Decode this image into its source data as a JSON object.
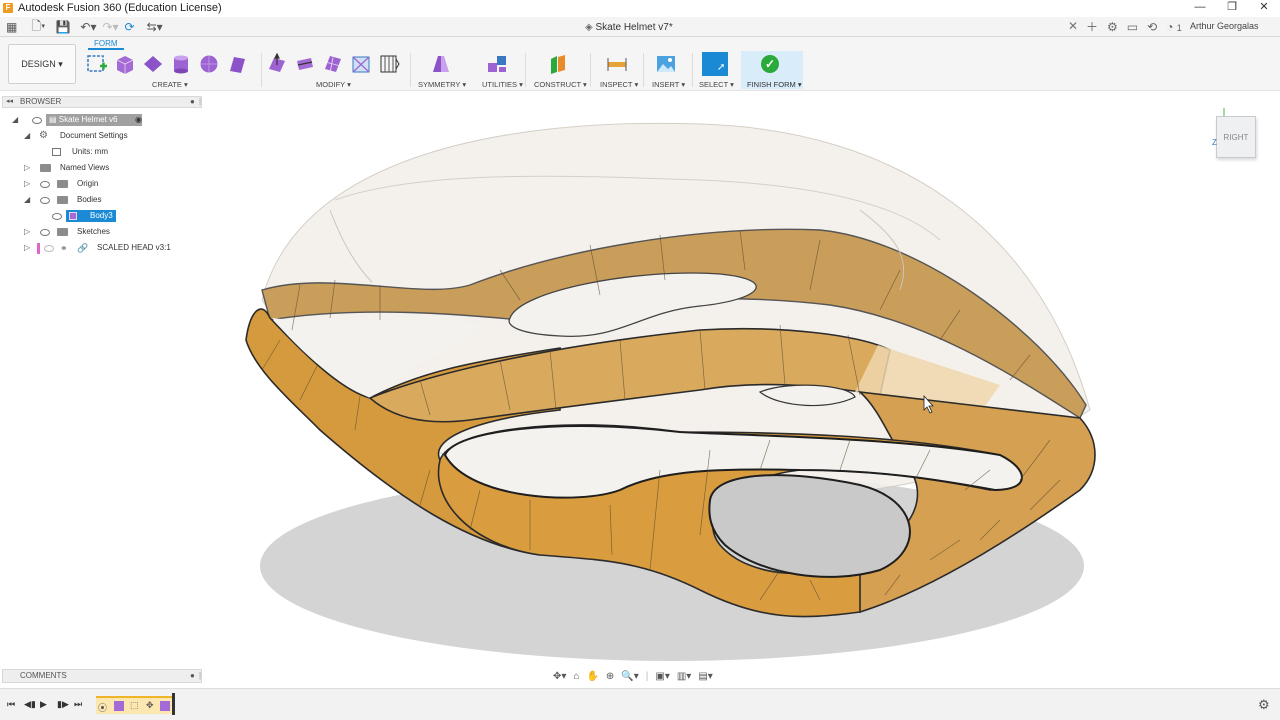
{
  "window": {
    "title": "Autodesk Fusion 360 (Education License)",
    "controls": [
      "—",
      "❐",
      "✕"
    ]
  },
  "tabbar": {
    "doc_tab": "Skate Helmet v7*",
    "notifications": "1",
    "user": "Arthur Georgalas"
  },
  "toolbar": {
    "workspace": "DESIGN",
    "active_tab": "FORM",
    "groups": {
      "create": "CREATE",
      "modify": "MODIFY",
      "symmetry": "SYMMETRY",
      "utilities": "UTILITIES",
      "construct": "CONSTRUCT",
      "inspect": "INSPECT",
      "insert": "INSERT",
      "select": "SELECT",
      "finish": "FINISH FORM"
    }
  },
  "browser": {
    "title": "BROWSER",
    "root": "Skate Helmet v6",
    "items": [
      {
        "label": "Document Settings"
      },
      {
        "label": "Units: mm"
      },
      {
        "label": "Named Views"
      },
      {
        "label": "Origin"
      },
      {
        "label": "Bodies"
      },
      {
        "label": "Body3"
      },
      {
        "label": "Sketches"
      },
      {
        "label": "SCALED HEAD v3:1"
      }
    ]
  },
  "comments": {
    "title": "COMMENTS"
  },
  "viewcube": {
    "face": "RIGHT",
    "axis_z": "Z"
  },
  "colors": {
    "accent": "#1a8ad4",
    "body_orange": "#e2a03a",
    "body_tan": "#d9ac6a",
    "finish_green": "#2aaa3a",
    "timeline_bar": "#f0b429"
  },
  "icons": {
    "grid": "grid-icon",
    "file": "file-icon",
    "save": "save-icon",
    "undo": "undo-icon",
    "redo": "redo-icon",
    "finish": "checkmark-icon",
    "gear": "gear-icon"
  }
}
